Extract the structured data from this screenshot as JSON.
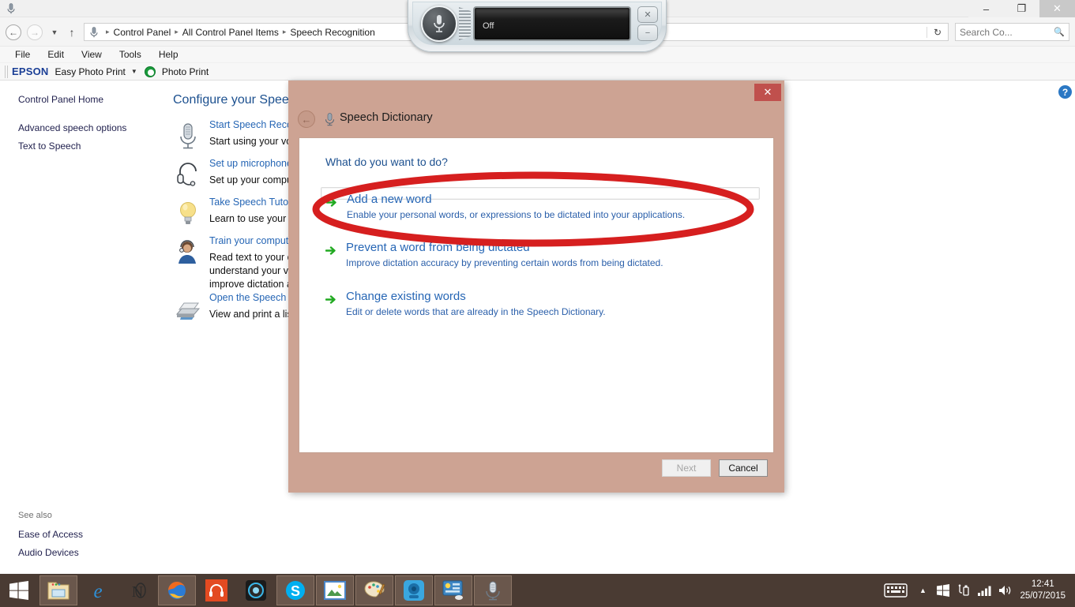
{
  "window": {
    "icon": "microphone-icon",
    "minimize": "–",
    "maximize": "❐",
    "close": "✕"
  },
  "address_bar": {
    "back": "←",
    "forward": "→",
    "recent": "▼",
    "up": "↑",
    "chevron": "ⱟ",
    "refresh": "↻",
    "breadcrumb": [
      "Control Panel",
      "All Control Panel Items",
      "Speech Recognition"
    ],
    "separator": "▸"
  },
  "search": {
    "placeholder": "Search Co...",
    "icon": "🔍"
  },
  "menubar": {
    "items": [
      "File",
      "Edit",
      "View",
      "Tools",
      "Help"
    ]
  },
  "epson_toolbar": {
    "logo": "EPSON",
    "easy_photo_print": "Easy Photo Print",
    "chevron": "▼",
    "photo_print": "Photo Print"
  },
  "sidebar": {
    "home": "Control Panel Home",
    "advanced": "Advanced speech options",
    "text_to_speech": "Text to Speech",
    "see_also_label": "See also",
    "ease_of_access": "Ease of Access",
    "audio_devices": "Audio Devices"
  },
  "main": {
    "title": "Configure your Speech Recognition",
    "help_icon": "?",
    "items": [
      {
        "icon": "microphone-icon",
        "link": "Start Speech Recognition",
        "desc": "Start using your voice to control your computer."
      },
      {
        "icon": "headset-icon",
        "link": "Set up microphone",
        "desc": "Set up your computer to work properly with Speech Recognition."
      },
      {
        "icon": "lightbulb-icon",
        "link": "Take Speech Tutorial",
        "desc": "Learn to use your computer with speech."
      },
      {
        "icon": "person-headset-icon",
        "link": "Train your computer to better understand you",
        "desc": "Read text to your computer to improve your computer's ability to understand your voice. Doing this isn't necessary, but can help improve dictation accuracy."
      },
      {
        "icon": "printer-icon",
        "link": "Open the Speech Reference Card",
        "desc": "View and print a list of commands you can say."
      }
    ]
  },
  "speech_widget": {
    "mic_icon": "microphone-icon",
    "status": "Off",
    "button_minimize_icon": "✕",
    "button_collapse_icon": "−"
  },
  "dialog": {
    "title": "Speech Dictionary",
    "title_icon": "microphone-icon",
    "back_icon": "←",
    "close_icon": "✕",
    "question": "What do you want to do?",
    "options": [
      {
        "title": "Add a new word",
        "desc": "Enable your personal words, or expressions to be dictated into your applications.",
        "hovered": true
      },
      {
        "title": "Prevent a word from being dictated",
        "desc": "Improve dictation accuracy by preventing certain words from being dictated.",
        "hovered": false
      },
      {
        "title": "Change existing words",
        "desc": "Edit or delete words that are already in the Speech Dictionary.",
        "hovered": false
      }
    ],
    "next_label": "Next",
    "cancel_label": "Cancel",
    "background_color": "#cda393",
    "close_color": "#c0504d"
  },
  "annotation": {
    "shape": "ellipse",
    "color": "#d61f1f",
    "stroke_width": 8,
    "targets": "Add a new word"
  },
  "taskbar": {
    "start_icon": "windows-logo-icon",
    "items": [
      {
        "name": "file-explorer-icon",
        "active": true
      },
      {
        "name": "internet-explorer-icon",
        "active": false
      },
      {
        "name": "onenote-icon",
        "active": false
      },
      {
        "name": "firefox-icon",
        "active": true
      },
      {
        "name": "headphones-app-icon",
        "active": false
      },
      {
        "name": "camera-lens-icon",
        "active": false
      },
      {
        "name": "skype-icon",
        "active": true
      },
      {
        "name": "photos-icon",
        "active": true
      },
      {
        "name": "paint-icon",
        "active": true
      },
      {
        "name": "webcam-icon",
        "active": true
      },
      {
        "name": "control-panel-icon",
        "active": true
      },
      {
        "name": "speech-recognition-icon",
        "active": true
      }
    ],
    "tray": {
      "keyboard_icon": "⌨",
      "show_hidden_icon": "▲",
      "windows_icon": "windows-flag-icon",
      "usb_icon": "usb-icon",
      "network_icon": "network-bars-icon",
      "volume_icon": "🔊",
      "time": "12:41",
      "date": "25/07/2015"
    }
  }
}
